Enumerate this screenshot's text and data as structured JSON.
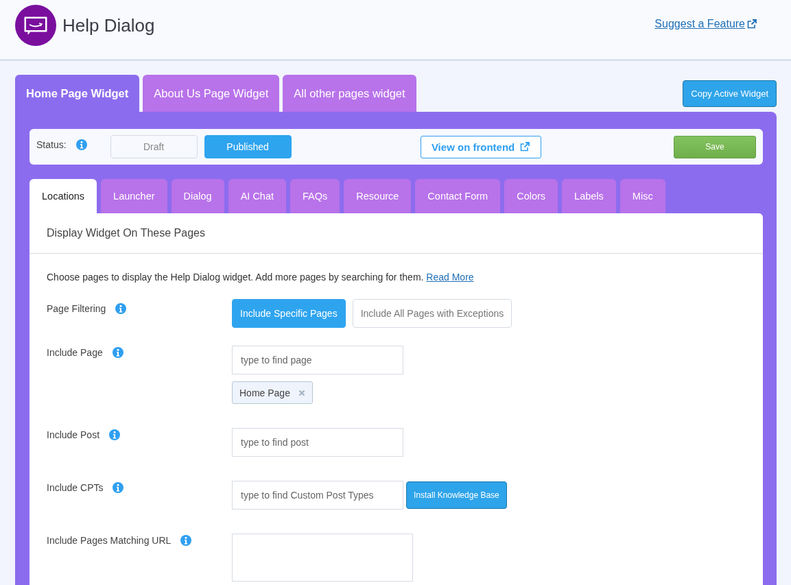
{
  "header": {
    "title": "Help Dialog",
    "link": "Suggest a Feature"
  },
  "widget_tabs": [
    {
      "label": "Home Page Widget",
      "selected": true
    },
    {
      "label": "About Us Page Widget",
      "selected": false
    },
    {
      "label": "All other pages widget",
      "selected": false
    }
  ],
  "copy_button": "Copy Active Widget",
  "status": {
    "label": "Status:",
    "options": [
      {
        "label": "Draft",
        "selected": false
      },
      {
        "label": "Published",
        "selected": true
      }
    ],
    "view_button": "View on frontend",
    "save_button": "Save"
  },
  "section_tabs": [
    {
      "label": "Locations",
      "selected": true
    },
    {
      "label": "Launcher",
      "selected": false
    },
    {
      "label": "Dialog",
      "selected": false
    },
    {
      "label": "AI Chat",
      "selected": false
    },
    {
      "label": "FAQs",
      "selected": false
    },
    {
      "label": "Resource",
      "selected": false
    },
    {
      "label": "Contact Form",
      "selected": false
    },
    {
      "label": "Colors",
      "selected": false
    },
    {
      "label": "Labels",
      "selected": false
    },
    {
      "label": "Misc",
      "selected": false
    }
  ],
  "panel": {
    "title": "Display Widget On These Pages",
    "description": "Choose pages to display the Help Dialog widget. Add more pages by searching for them.",
    "read_more": "Read More",
    "fields": [
      {
        "kind": "choice",
        "label": "Page Filtering",
        "options": [
          {
            "label": "Include Specific Pages",
            "selected": true
          },
          {
            "label": "Include All Pages with Exceptions",
            "selected": false
          }
        ]
      },
      {
        "kind": "search",
        "label": "Include Page",
        "placeholder": "type to find page",
        "tags": [
          "Home Page"
        ]
      },
      {
        "kind": "search",
        "label": "Include Post",
        "placeholder": "type to find post"
      },
      {
        "kind": "search",
        "label": "Include CPTs",
        "placeholder": "type to find Custom Post Types",
        "button": "Install Knowledge Base"
      },
      {
        "kind": "textarea",
        "label": "Include Pages Matching URL"
      }
    ]
  }
}
